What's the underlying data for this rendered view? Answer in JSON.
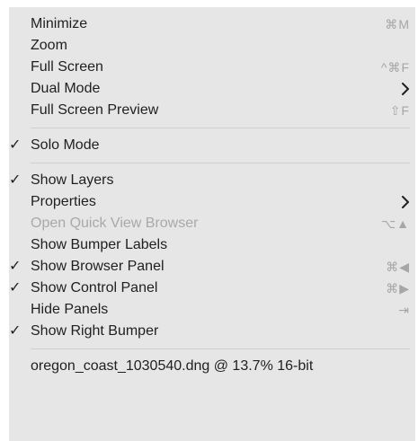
{
  "menu": {
    "groups": [
      [
        {
          "label": "Minimize",
          "shortcut": "⌘M",
          "checked": false,
          "submenu": false,
          "disabled": false
        },
        {
          "label": "Zoom",
          "shortcut": "",
          "checked": false,
          "submenu": false,
          "disabled": false
        },
        {
          "label": "Full Screen",
          "shortcut": "^⌘F",
          "checked": false,
          "submenu": false,
          "disabled": false
        },
        {
          "label": "Dual Mode",
          "shortcut": "",
          "checked": false,
          "submenu": true,
          "disabled": false
        },
        {
          "label": "Full Screen Preview",
          "shortcut": "⇧F",
          "checked": false,
          "submenu": false,
          "disabled": false
        }
      ],
      [
        {
          "label": "Solo Mode",
          "shortcut": "",
          "checked": true,
          "submenu": false,
          "disabled": false
        }
      ],
      [
        {
          "label": "Show Layers",
          "shortcut": "",
          "checked": true,
          "submenu": false,
          "disabled": false
        },
        {
          "label": "Properties",
          "shortcut": "",
          "checked": false,
          "submenu": true,
          "disabled": false
        },
        {
          "label": "Open Quick View Browser",
          "shortcut": "⌥▲",
          "checked": false,
          "submenu": false,
          "disabled": true
        },
        {
          "label": "Show Bumper Labels",
          "shortcut": "",
          "checked": false,
          "submenu": false,
          "disabled": false
        },
        {
          "label": "Show Browser Panel",
          "shortcut": "⌘◀",
          "checked": true,
          "submenu": false,
          "disabled": false
        },
        {
          "label": "Show Control Panel",
          "shortcut": "⌘▶",
          "checked": true,
          "submenu": false,
          "disabled": false
        },
        {
          "label": "Hide Panels",
          "shortcut": "⇥",
          "checked": false,
          "submenu": false,
          "disabled": false
        },
        {
          "label": "Show Right Bumper",
          "shortcut": "",
          "checked": true,
          "submenu": false,
          "disabled": false
        }
      ]
    ],
    "footer_item": "oregon_coast_1030540.dng @ 13.7% 16-bit",
    "checkmark": "✓",
    "colors": {
      "menu_bg": "#e6e6e6",
      "text": "#1f1f1f",
      "disabled_text": "#a9a9a9",
      "shortcut_text": "#a6a6a6",
      "separator": "#cfcfcf"
    },
    "icons": {
      "check": "checkmark-icon",
      "submenu": "chevron-right-icon"
    }
  }
}
